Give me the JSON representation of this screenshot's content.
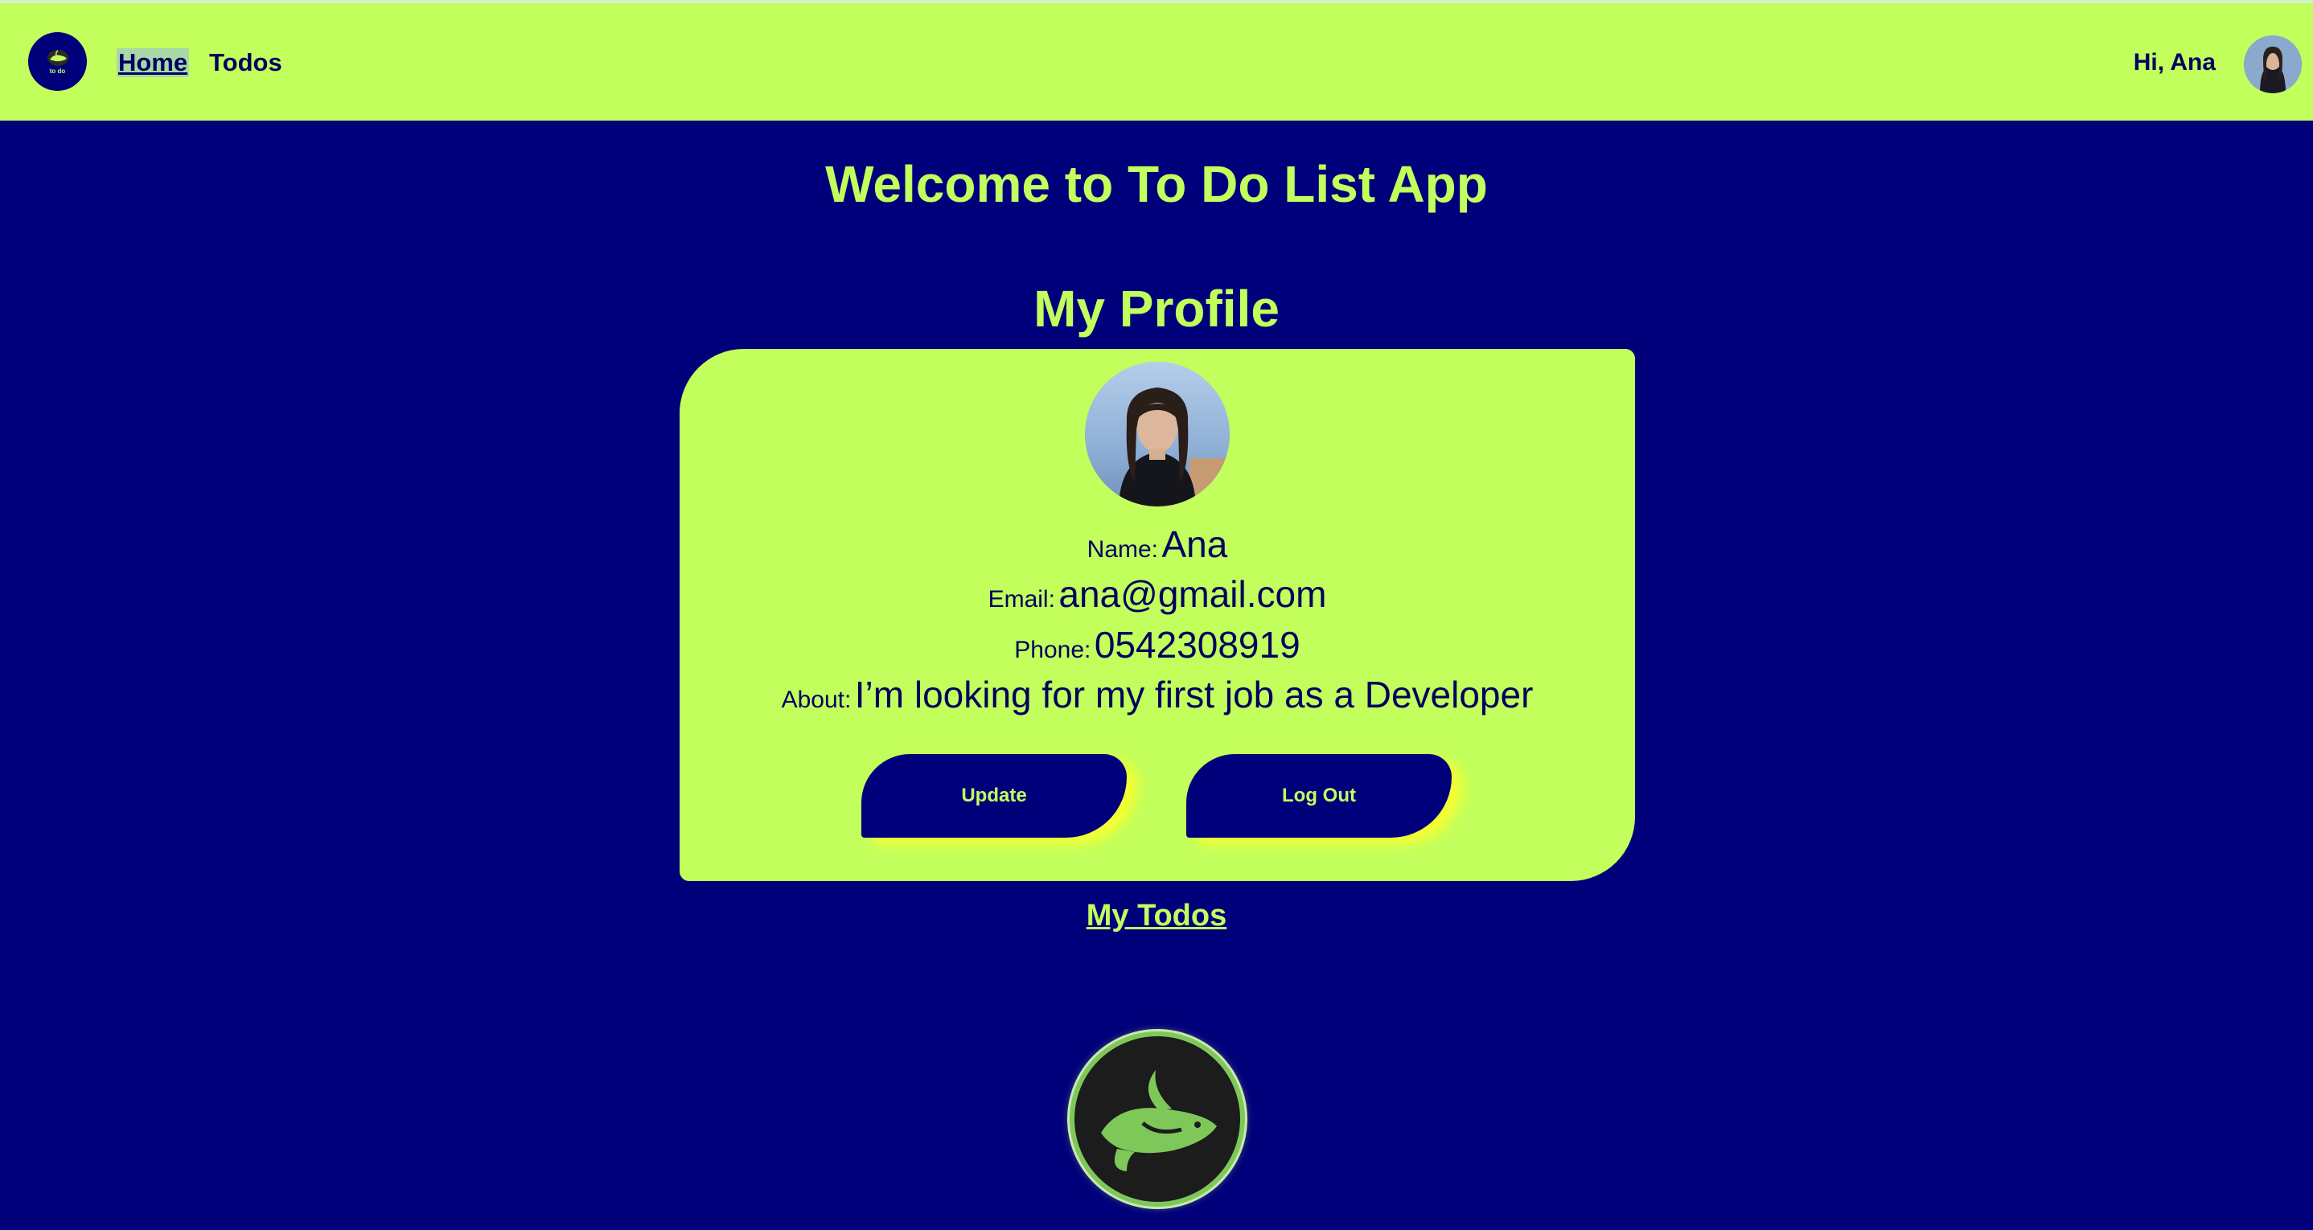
{
  "navbar": {
    "logo_text": "to do",
    "links": {
      "home": "Home",
      "todos": "Todos"
    },
    "greeting": "Hi, Ana"
  },
  "main": {
    "welcome_title": "Welcome to To Do List App",
    "profile_title": "My Profile"
  },
  "profile": {
    "name_label": "Name:",
    "name_value": "Ana",
    "email_label": "Email:",
    "email_value": "ana@gmail.com",
    "phone_label": "Phone:",
    "phone_value": "0542308919",
    "about_label": "About:",
    "about_value": "I’m looking for my first job as a Developer",
    "update_button": "Update",
    "logout_button": "Log Out"
  },
  "my_todos_link": "My Todos",
  "colors": {
    "background": "#00007b",
    "accent": "#c2ff5d",
    "text_dark": "#00005e",
    "button_glow": "#ffff28"
  },
  "icons": {
    "nav_logo": "whale-logo-icon",
    "footer_logo": "whale-logo-icon",
    "avatar": "user-avatar",
    "profile_photo": "profile-photo"
  }
}
